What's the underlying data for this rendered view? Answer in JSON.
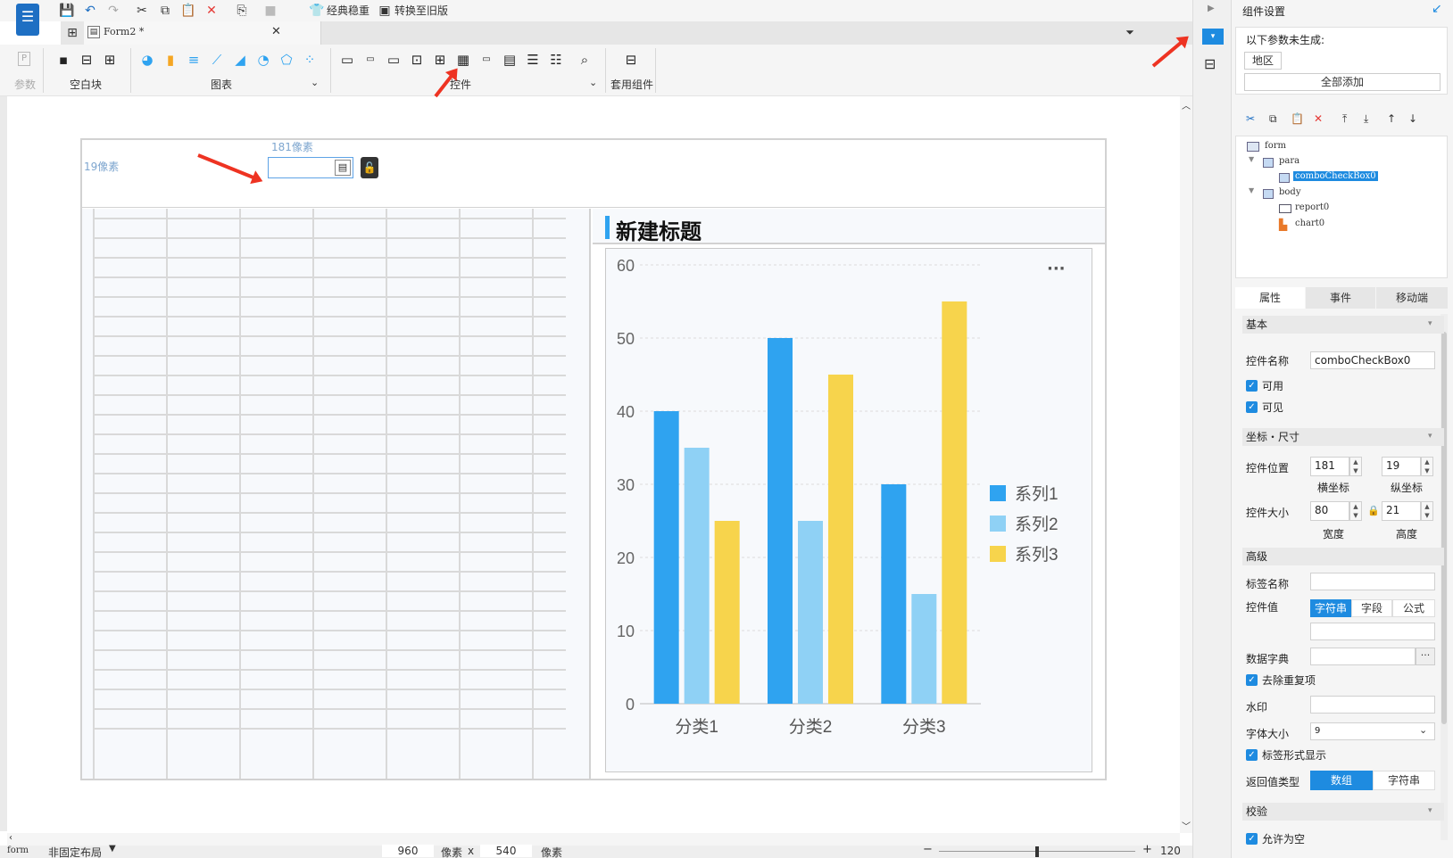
{
  "toolbar": {
    "classic_label": "经典稳重",
    "convert_label": "转换至旧版"
  },
  "tab": {
    "title": "Form2 *"
  },
  "ribbon": {
    "param_label": "参数",
    "blank_label": "空白块",
    "chart_label": "图表",
    "widget_label": "控件",
    "template_label": "套用组件"
  },
  "canvas": {
    "x_hint": "181像素",
    "y_hint": "19像素",
    "chart_title": "新建标题",
    "more_icon": "···"
  },
  "chart_data": {
    "type": "bar",
    "categories": [
      "分类1",
      "分类2",
      "分类3"
    ],
    "series": [
      {
        "name": "系列1",
        "values": [
          40,
          50,
          30
        ],
        "color": "#2fa3f0"
      },
      {
        "name": "系列2",
        "values": [
          35,
          25,
          15
        ],
        "color": "#8fd1f5"
      },
      {
        "name": "系列3",
        "values": [
          25,
          45,
          55
        ],
        "color": "#f7d44c"
      }
    ],
    "ylim": [
      0,
      60
    ],
    "yticks": [
      "0",
      "10",
      "20",
      "30",
      "40",
      "50",
      "60"
    ],
    "grid": true,
    "legend": "right"
  },
  "status": {
    "form": "form",
    "layout": "非固定布局",
    "width": "960",
    "width_unit": "像素",
    "times": "x",
    "height": "540",
    "height_unit": "像素",
    "zoom": "120",
    "zoom_unit": "%"
  },
  "right": {
    "panel_title": "组件设置",
    "not_generated": "以下参数未生成:",
    "region_tag": "地区",
    "add_all": "全部添加",
    "tree": {
      "form": "form",
      "para": "para",
      "combo": "comboCheckBox0",
      "body": "body",
      "report": "report0",
      "chart": "chart0"
    },
    "tabs": [
      "属性",
      "事件",
      "移动端"
    ],
    "basic": "基本",
    "name_label": "控件名称",
    "name_value": "comboCheckBox0",
    "enabled": "可用",
    "visible": "可见",
    "coords_section": "坐标・尺寸",
    "pos_label": "控件位置",
    "pos_x": "181",
    "pos_y": "19",
    "x_caption": "横坐标",
    "y_caption": "纵坐标",
    "size_label": "控件大小",
    "size_w": "80",
    "size_h": "21",
    "w_caption": "宽度",
    "h_caption": "高度",
    "advanced": "高级",
    "tag_name": "标签名称",
    "widget_value": "控件值",
    "value_types": [
      "字符串",
      "字段",
      "公式"
    ],
    "dict_label": "数据字典",
    "dict_btn": "···",
    "dedupe": "去除重复项",
    "watermark": "水印",
    "font_size_label": "字体大小",
    "font_size_value": "9",
    "tag_display": "标签形式显示",
    "return_type": "返回值类型",
    "return_options": [
      "数组",
      "字符串"
    ],
    "validate": "校验",
    "allow_empty": "允许为空"
  }
}
